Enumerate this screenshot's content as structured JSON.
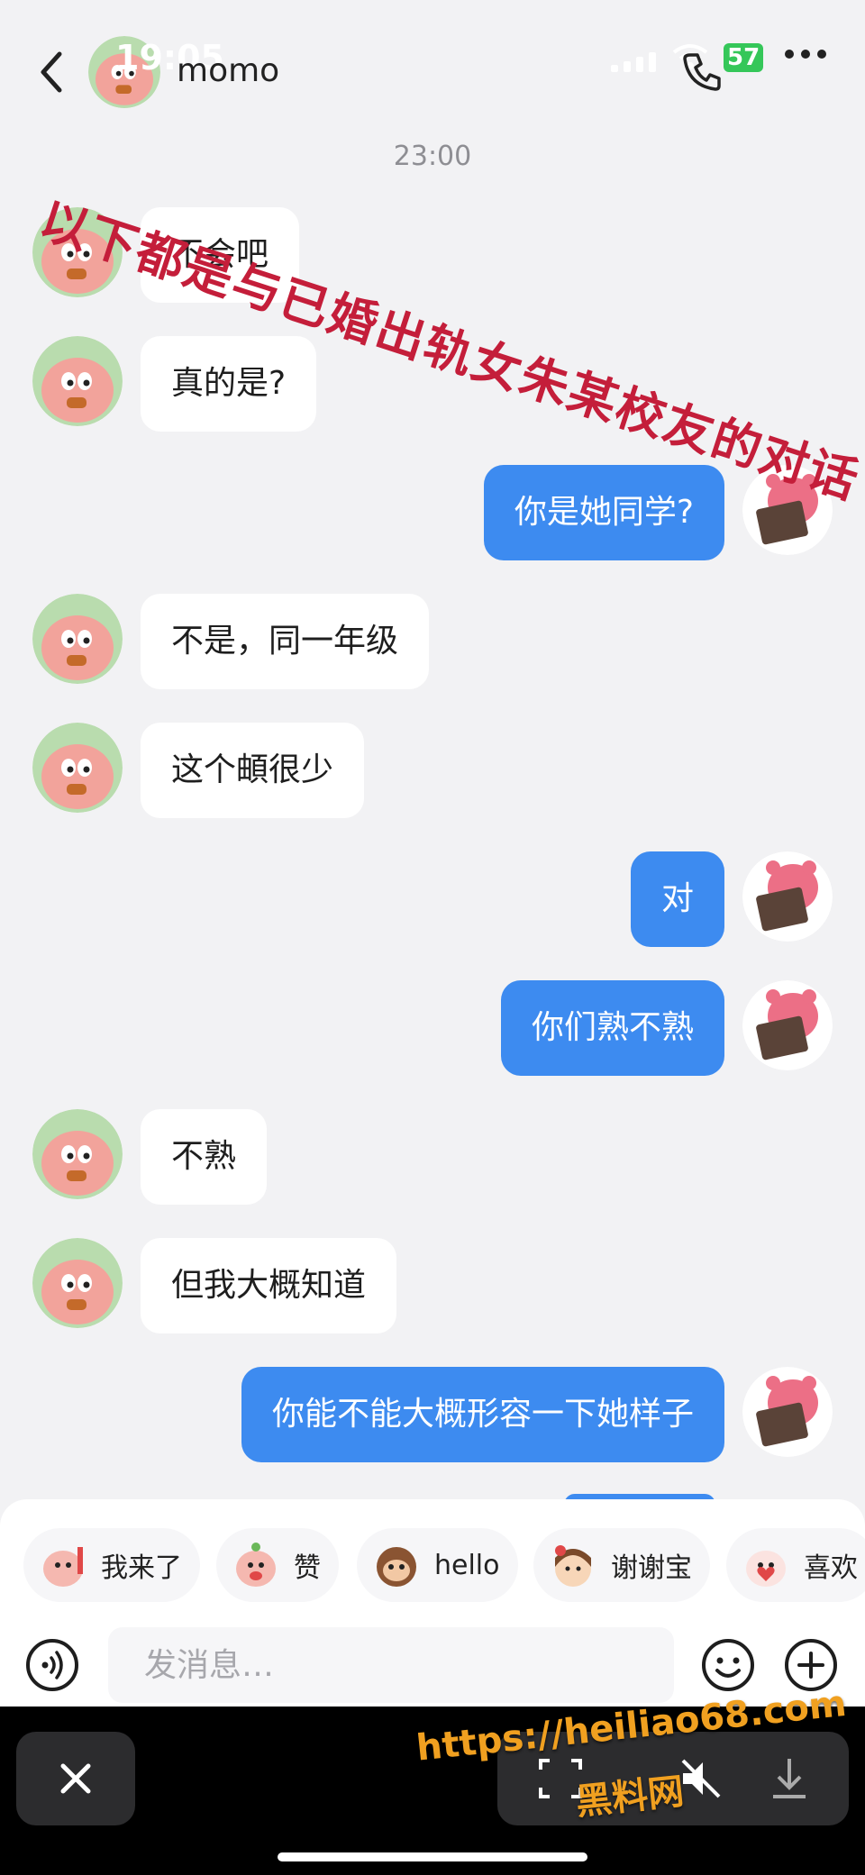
{
  "status_bar": {
    "time": "19:05",
    "battery": "57"
  },
  "header": {
    "contact_name": "momo"
  },
  "timestamp": "23:00",
  "watermark_overlay": "以下都是与已婚出轨女朱某校友的对话",
  "messages": [
    {
      "side": "in",
      "text": "不会吧"
    },
    {
      "side": "in",
      "text": "真的是?"
    },
    {
      "side": "out",
      "text": "你是她同学?"
    },
    {
      "side": "in",
      "text": "不是，同一年级"
    },
    {
      "side": "in",
      "text": "这个頔很少"
    },
    {
      "side": "out",
      "text": "对"
    },
    {
      "side": "out",
      "text": "你们熟不熟"
    },
    {
      "side": "in",
      "text": "不熟"
    },
    {
      "side": "in",
      "text": "但我大概知道"
    },
    {
      "side": "out",
      "text": "你能不能大概形容一下她样子"
    }
  ],
  "quick_replies": [
    {
      "label": "我来了",
      "sticker": "waving-pig-sticker"
    },
    {
      "label": "赞",
      "sticker": "thumbs-up-pig-sticker"
    },
    {
      "label": "hello",
      "sticker": "monkey-sticker"
    },
    {
      "label": "谢谢宝",
      "sticker": "flower-girl-sticker"
    },
    {
      "label": "喜欢",
      "sticker": "heart-pig-sticker"
    }
  ],
  "composer": {
    "placeholder": "发消息…"
  },
  "site_watermark": {
    "url": "https://heiliao68.com",
    "name": "黑料网"
  },
  "colors": {
    "outgoing_bubble": "#3d8bf0",
    "incoming_bubble": "#ffffff",
    "background": "#f2f2f4",
    "watermark": "#c41e3a",
    "site_watermark": "#f0a020"
  }
}
